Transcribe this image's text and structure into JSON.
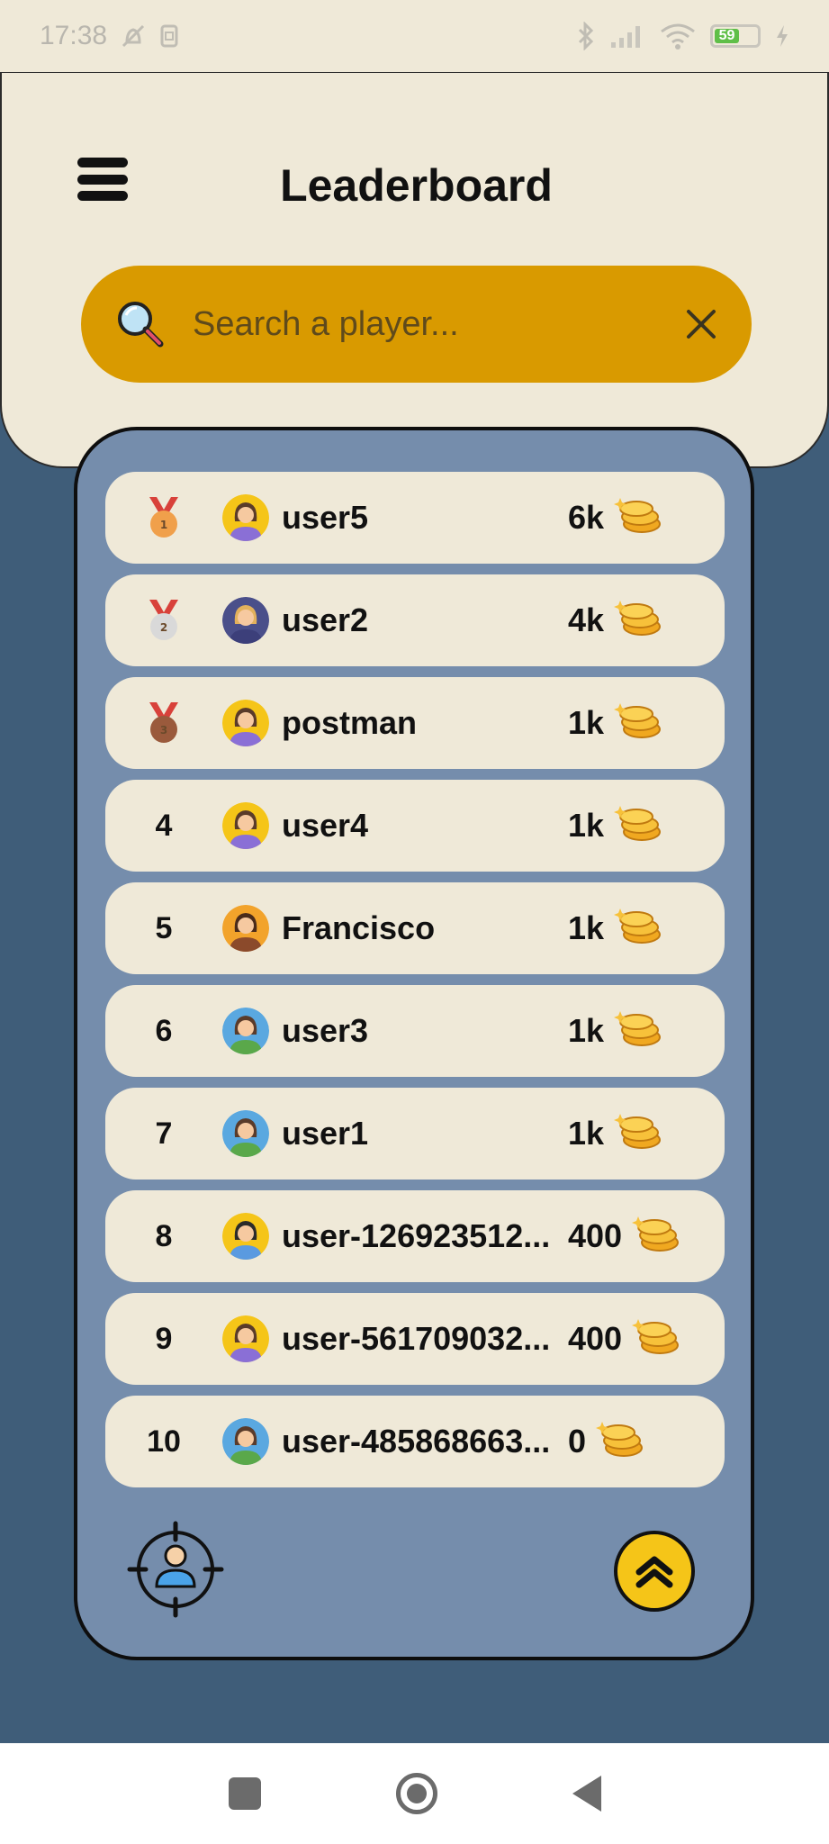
{
  "status_bar": {
    "time": "17:38",
    "battery": "59"
  },
  "header": {
    "title": "Leaderboard"
  },
  "search": {
    "placeholder": "Search a player..."
  },
  "colors": {
    "background": "#3f5d79",
    "panel": "#758dac",
    "card": "#efe9d8",
    "search": "#d99a00",
    "accent": "#f5c518"
  },
  "leaderboard": {
    "rows": [
      {
        "rank": "1",
        "medal": "gold",
        "avatar": "woman-avatar",
        "name": "user5",
        "score": "6k"
      },
      {
        "rank": "2",
        "medal": "silver",
        "avatar": "blonde-woman-avatar",
        "name": "user2",
        "score": "4k"
      },
      {
        "rank": "3",
        "medal": "bronze",
        "avatar": "woman-avatar",
        "name": "postman",
        "score": "1k"
      },
      {
        "rank": "4",
        "medal": null,
        "avatar": "woman-avatar",
        "name": "user4",
        "score": "1k"
      },
      {
        "rank": "5",
        "medal": null,
        "avatar": "man-avatar",
        "name": "Francisco",
        "score": "1k"
      },
      {
        "rank": "6",
        "medal": null,
        "avatar": "woman-green-avatar",
        "name": "user3",
        "score": "1k"
      },
      {
        "rank": "7",
        "medal": null,
        "avatar": "woman-green-avatar",
        "name": "user1",
        "score": "1k"
      },
      {
        "rank": "8",
        "medal": null,
        "avatar": "man-ponytail-avatar",
        "name": "user-126923512...",
        "score": "400"
      },
      {
        "rank": "9",
        "medal": null,
        "avatar": "woman-avatar",
        "name": "user-561709032...",
        "score": "400"
      },
      {
        "rank": "10",
        "medal": null,
        "avatar": "woman-green-avatar",
        "name": "user-485868663...",
        "score": "0"
      }
    ]
  },
  "icons": {
    "menu": "hamburger-icon",
    "search": "magnifier-icon",
    "clear": "close-icon",
    "coins": "coins-icon",
    "locate": "locate-me-icon",
    "scroll_top": "double-chevron-up-icon"
  }
}
